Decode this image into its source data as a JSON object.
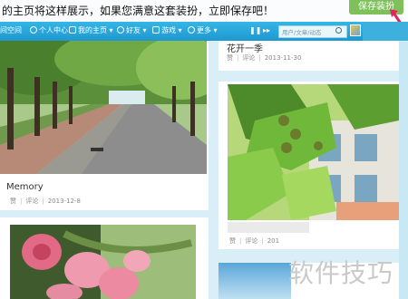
{
  "banner": {
    "text": "的主页将这样展示，如果您满意这套装扮，立即保存吧！",
    "save_label": "保存装扮"
  },
  "nav": {
    "items": [
      {
        "label": "间空间",
        "icon": "home-icon"
      },
      {
        "label": "个人中心",
        "icon": "user-icon"
      },
      {
        "label": "我的主页",
        "icon": "house-icon"
      },
      {
        "label": "好友",
        "icon": "friends-icon"
      },
      {
        "label": "游戏",
        "icon": "game-icon"
      },
      {
        "label": "更多",
        "icon": "more-icon"
      }
    ],
    "search_placeholder": "用户/文章/动态"
  },
  "posts": [
    {
      "title": "Memory",
      "like": "赞",
      "comment": "评论",
      "date": "2013-12-8"
    },
    {
      "title": "花开一季",
      "like": "赞",
      "comment": "评论",
      "date": "2013-11-30"
    },
    {
      "title": "",
      "like": "赞",
      "comment": "评论",
      "date": "201"
    }
  ],
  "watermark": "软件技巧",
  "colors": {
    "nav": "#2aa8de",
    "save_button": "#7fbf5c",
    "background": "#d9eef7",
    "arrow": "#e0245e"
  }
}
